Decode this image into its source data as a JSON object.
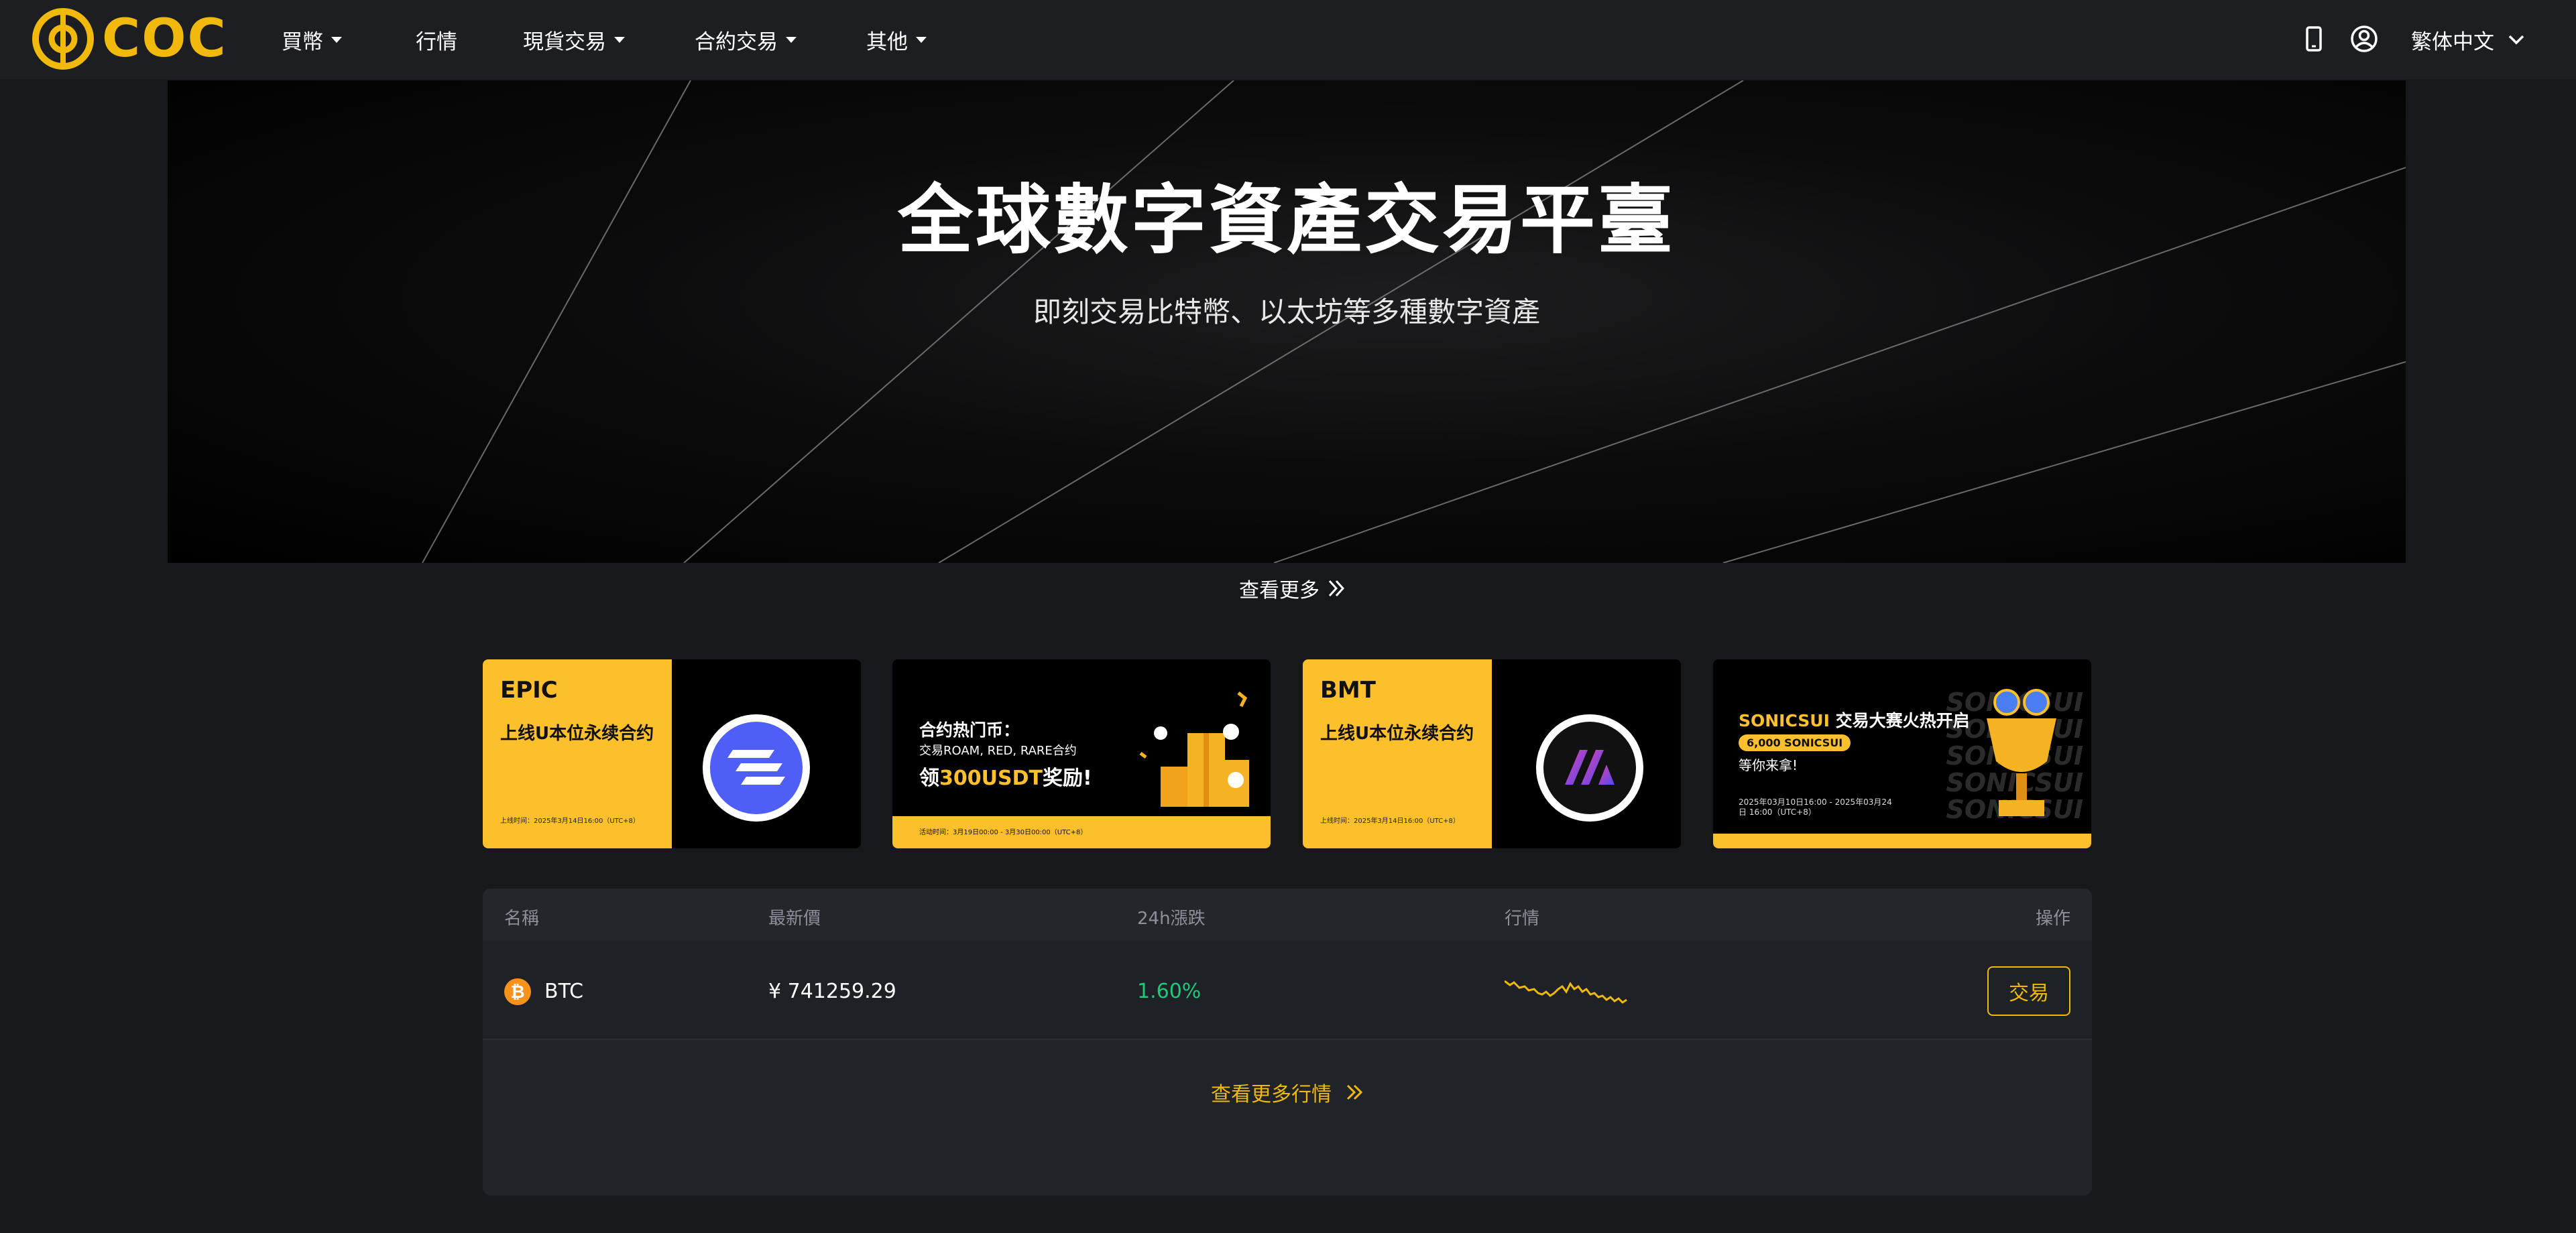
{
  "brand": {
    "name": "COC",
    "accent_color": "#f0b90b"
  },
  "nav": {
    "items": [
      {
        "label": "買幣",
        "has_dropdown": true
      },
      {
        "label": "行情",
        "has_dropdown": false
      },
      {
        "label": "現貨交易",
        "has_dropdown": true
      },
      {
        "label": "合約交易",
        "has_dropdown": true
      },
      {
        "label": "其他",
        "has_dropdown": true
      }
    ],
    "icons": [
      "mobile-icon",
      "user-icon"
    ],
    "language": "繁体中文"
  },
  "hero": {
    "title": "全球數字資產交易平臺",
    "subtitle": "即刻交易比特幣、以太坊等多種數字資產",
    "see_more": "查看更多"
  },
  "banners": [
    {
      "code": "EPIC",
      "subtitle": "上线U本位永续合约",
      "date": "上线时间：2025年3月14日16:00（UTC+8）",
      "icon": "epic-coin-icon",
      "color": "#4f5ef7"
    },
    {
      "line1": "合约热门币：",
      "line2": "交易ROAM, RED, RARE合约",
      "line3_prefix": "领",
      "line3_highlight": "300USDT",
      "line3_suffix": "奖励!",
      "date": "活动时间：3月19日00:00 - 3月30日00:00（UTC+8）"
    },
    {
      "code": "BMT",
      "subtitle": "上线U本位永续合约",
      "date": "上线时间：2025年3月14日16:00（UTC+8）",
      "icon": "bmt-coin-icon",
      "color": "#8a3ffc"
    },
    {
      "title_highlight": "SONICSUI",
      "title_rest": " 交易大赛火热开启",
      "pill": "6,000 SONICSUI",
      "line2": "等你来拿!",
      "date": "2025年03月10日16:00 - 2025年03月24日 16:00（UTC+8）",
      "watermark": [
        "SONICSUI",
        "SONICSUI",
        "SONICSUI",
        "SONICSUI",
        "SONICSUI"
      ]
    }
  ],
  "market": {
    "headers": {
      "name": "名稱",
      "price": "最新價",
      "change": "24h漲跌",
      "trend": "行情",
      "action": "操作"
    },
    "rows": [
      {
        "icon": "btc-coin-icon",
        "symbol": "BTC",
        "price": "¥ 741259.29",
        "change": "1.60%",
        "change_color": "#21c77a",
        "action": "交易"
      }
    ],
    "see_more": "查看更多行情"
  }
}
